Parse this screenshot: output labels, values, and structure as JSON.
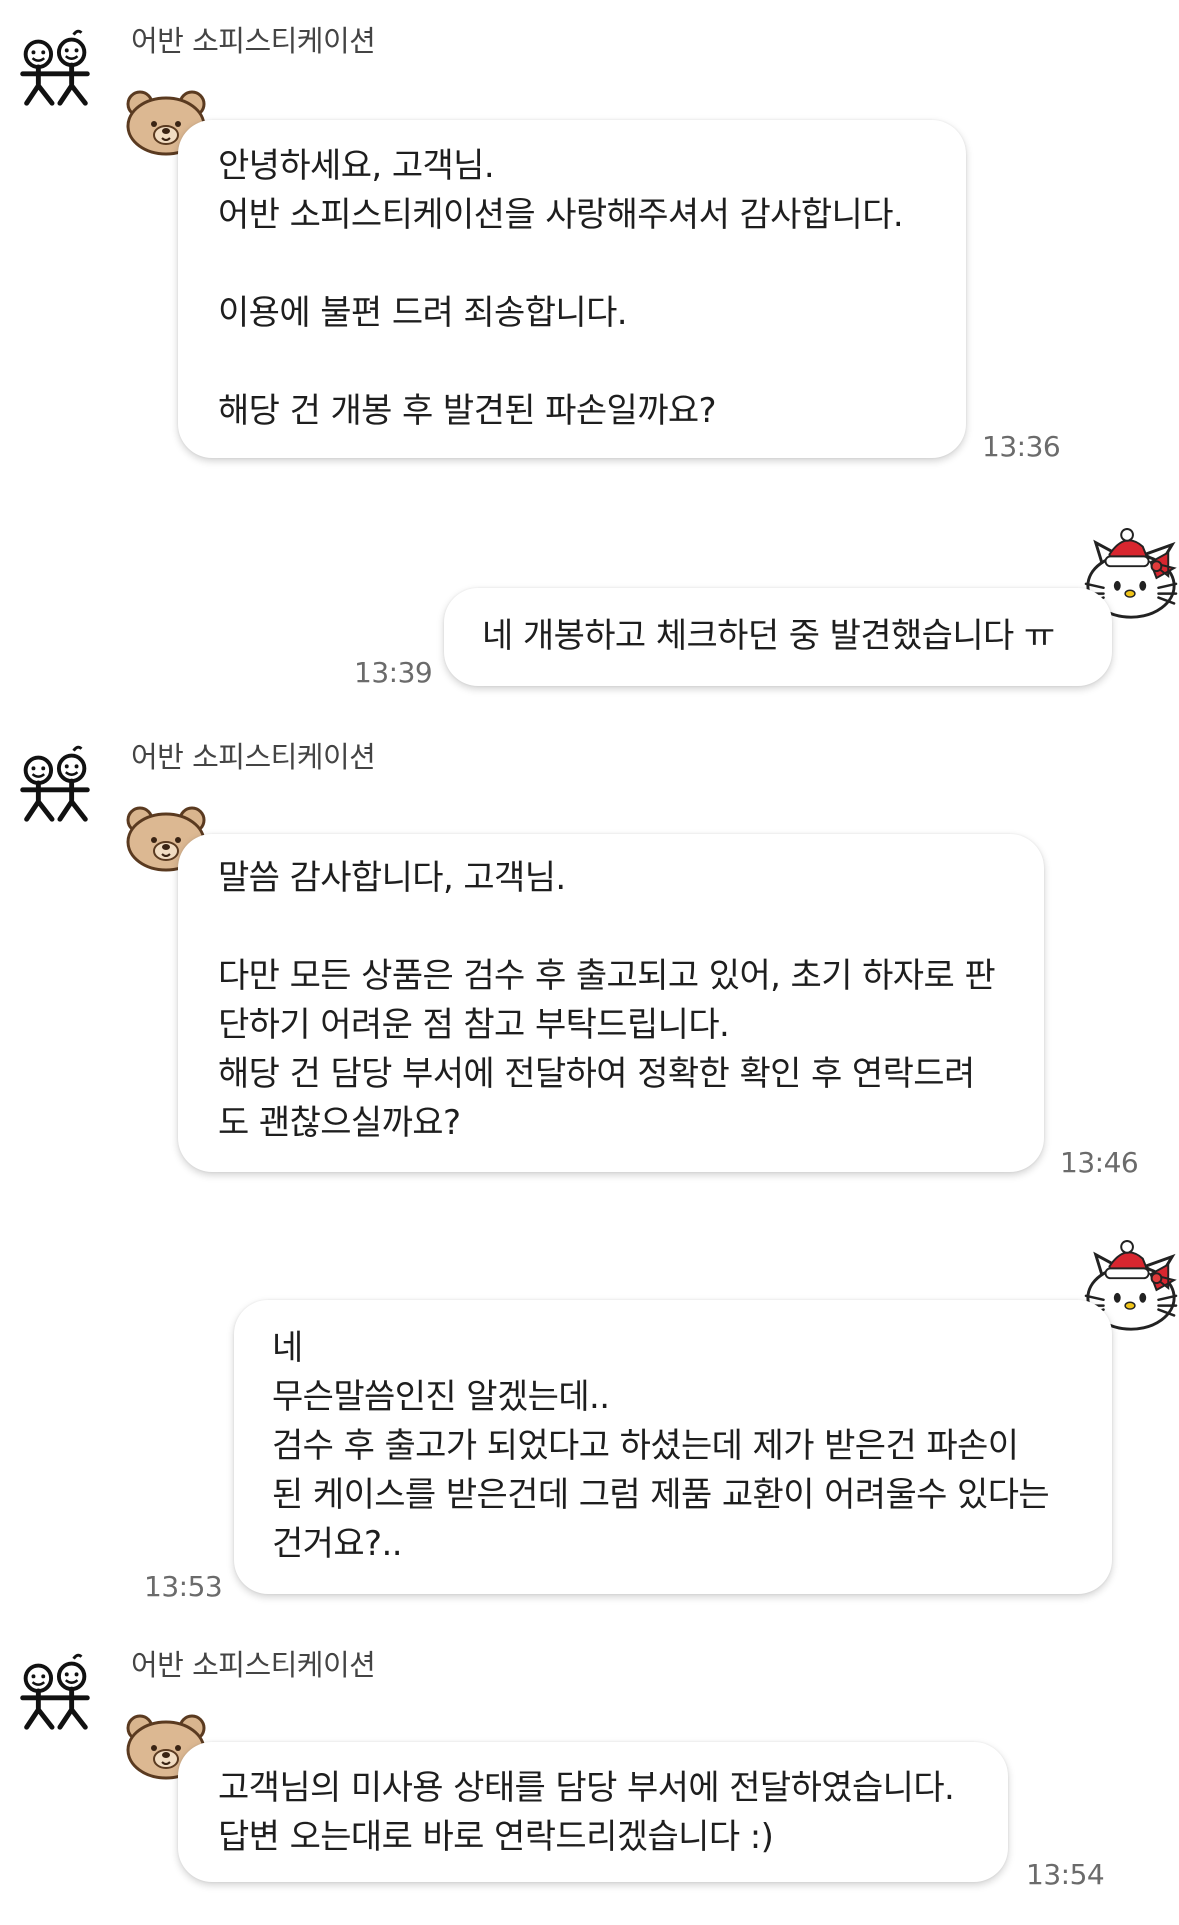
{
  "sender": {
    "name": "어반 소피스티케이션"
  },
  "messages": [
    {
      "text": "안녕하세요, 고객님.\n어반 소피스티케이션을 사랑해주셔서 감사합니다.\n\n이용에 불편 드려 죄송합니다.\n\n해당 건 개봉 후 발견된 파손일까요?",
      "time": "13:36"
    },
    {
      "text": "네 개봉하고 체크하던 중 발견했습니다 ㅠ",
      "time": "13:39"
    },
    {
      "text": "말씀 감사합니다, 고객님.\n\n다만 모든 상품은 검수 후 출고되고 있어, 초기 하자로 판\n단하기 어려운 점 참고 부탁드립니다.\n해당 건 담당 부서에 전달하여 정확한 확인 후 연락드려\n도 괜찮으실까요?",
      "time": "13:46"
    },
    {
      "text": "네\n무슨말씀인진 알겠는데..\n검수 후 출고가 되었다고 하셨는데 제가 받은건 파손이\n된 케이스를 받은건데 그럼 제품 교환이 어려울수 있다는\n건거요?..",
      "time": "13:53"
    },
    {
      "text": "고객님의 미사용 상태를 담당 부서에 전달하였습니다.\n답변 오는대로 바로 연락드리겠습니다 :)",
      "time": "13:54"
    }
  ],
  "icons": {
    "sender_avatar": "stick-figures-icon",
    "agent_sticker": "bear-face-icon",
    "user_sticker": "hello-kitty-santa-icon"
  }
}
